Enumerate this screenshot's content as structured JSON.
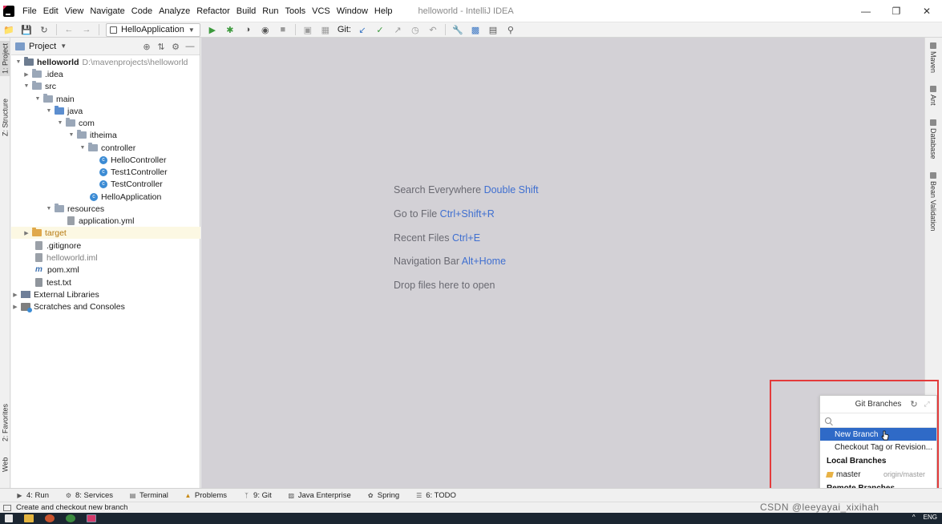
{
  "window": {
    "title": "helloworld - IntelliJ IDEA",
    "menu": [
      "File",
      "Edit",
      "View",
      "Navigate",
      "Code",
      "Analyze",
      "Refactor",
      "Build",
      "Run",
      "Tools",
      "VCS",
      "Window",
      "Help"
    ]
  },
  "toolbar": {
    "run_config": "HelloApplication",
    "git_label": "Git:"
  },
  "left_stripe": {
    "tabs": [
      "1: Project",
      "Z: Structure",
      "2: Favorites",
      "Web"
    ]
  },
  "right_stripe": {
    "tabs": [
      "Maven",
      "Ant",
      "Database",
      "Bean Validation"
    ]
  },
  "project_panel": {
    "title": "Project",
    "tree": [
      {
        "label": "helloworld",
        "path": "D:\\mavenprojects\\helloworld"
      },
      {
        "label": ".idea"
      },
      {
        "label": "src"
      },
      {
        "label": "main"
      },
      {
        "label": "java"
      },
      {
        "label": "com"
      },
      {
        "label": "itheima"
      },
      {
        "label": "controller"
      },
      {
        "label": "HelloController"
      },
      {
        "label": "Test1Controller"
      },
      {
        "label": "TestController"
      },
      {
        "label": "HelloApplication"
      },
      {
        "label": "resources"
      },
      {
        "label": "application.yml"
      },
      {
        "label": "target"
      },
      {
        "label": ".gitignore"
      },
      {
        "label": "helloworld.iml"
      },
      {
        "label": "pom.xml"
      },
      {
        "label": "test.txt"
      },
      {
        "label": "External Libraries"
      },
      {
        "label": "Scratches and Consoles"
      }
    ]
  },
  "editor": {
    "hints": [
      {
        "text": "Search Everywhere",
        "key": "Double Shift"
      },
      {
        "text": "Go to File",
        "key": "Ctrl+Shift+R"
      },
      {
        "text": "Recent Files",
        "key": "Ctrl+E"
      },
      {
        "text": "Navigation Bar",
        "key": "Alt+Home"
      },
      {
        "text": "Drop files here to open",
        "key": ""
      }
    ]
  },
  "git_branches": {
    "title": "Git Branches",
    "search_placeholder": "",
    "actions": [
      "New Branch",
      "Checkout Tag or Revision..."
    ],
    "local_header": "Local Branches",
    "local": [
      {
        "name": "master",
        "tracking": "origin/master"
      }
    ],
    "remote_header": "Remote Branches"
  },
  "bottom_tabs": [
    "4: Run",
    "8: Services",
    "Terminal",
    "Problems",
    "9: Git",
    "Java Enterprise",
    "Spring",
    "6: TODO"
  ],
  "status": {
    "message": "Create and checkout new branch"
  },
  "watermark": "CSDN @leeyayai_xixihah",
  "taskbar": {
    "lang": "ENG"
  }
}
